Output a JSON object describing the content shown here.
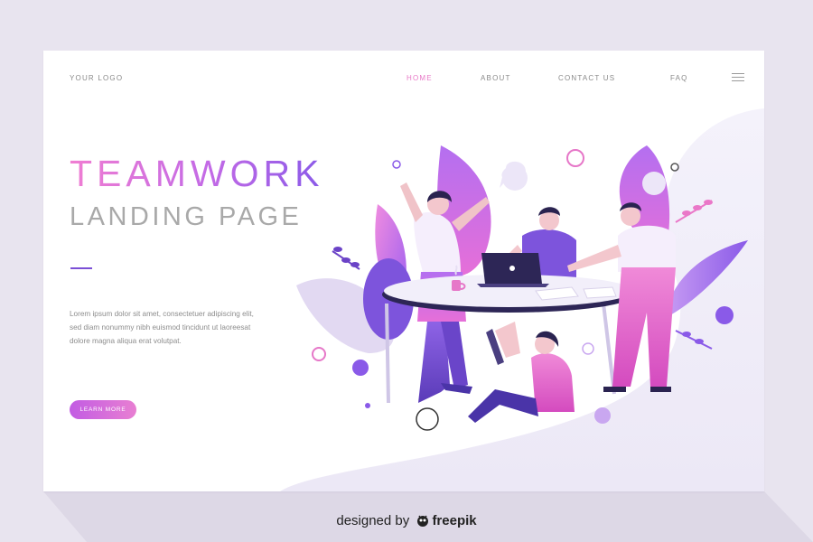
{
  "nav": {
    "logo": "YOUR LOGO",
    "links": [
      {
        "label": "HOME",
        "active": true
      },
      {
        "label": "ABOUT",
        "active": false
      },
      {
        "label": "CONTACT US",
        "active": false
      },
      {
        "label": "FAQ",
        "active": false
      }
    ],
    "menu_icon": "hamburger-menu-icon"
  },
  "hero": {
    "title": "TEAMWORK",
    "subtitle": "LANDING PAGE",
    "body_lines": [
      "Lorem ipsum dolor sit amet, consectetuer adipiscing elit,",
      "sed diam nonummy nibh euismod tincidunt ut laoreesat",
      "dolore magna aliqua erat volutpat."
    ],
    "cta_label": "LEARN MORE"
  },
  "credit": {
    "prefix": "designed by",
    "brand": "freepik",
    "icon": "freepik-logo-icon"
  },
  "colors": {
    "accent_pink": "#e879c7",
    "accent_purple": "#7b4fd6",
    "title_gradient": [
      "#f07ed2",
      "#c36ae6",
      "#8a5ae8"
    ],
    "text_gray": "#8d8d8d",
    "background": "#e8e4ef"
  }
}
